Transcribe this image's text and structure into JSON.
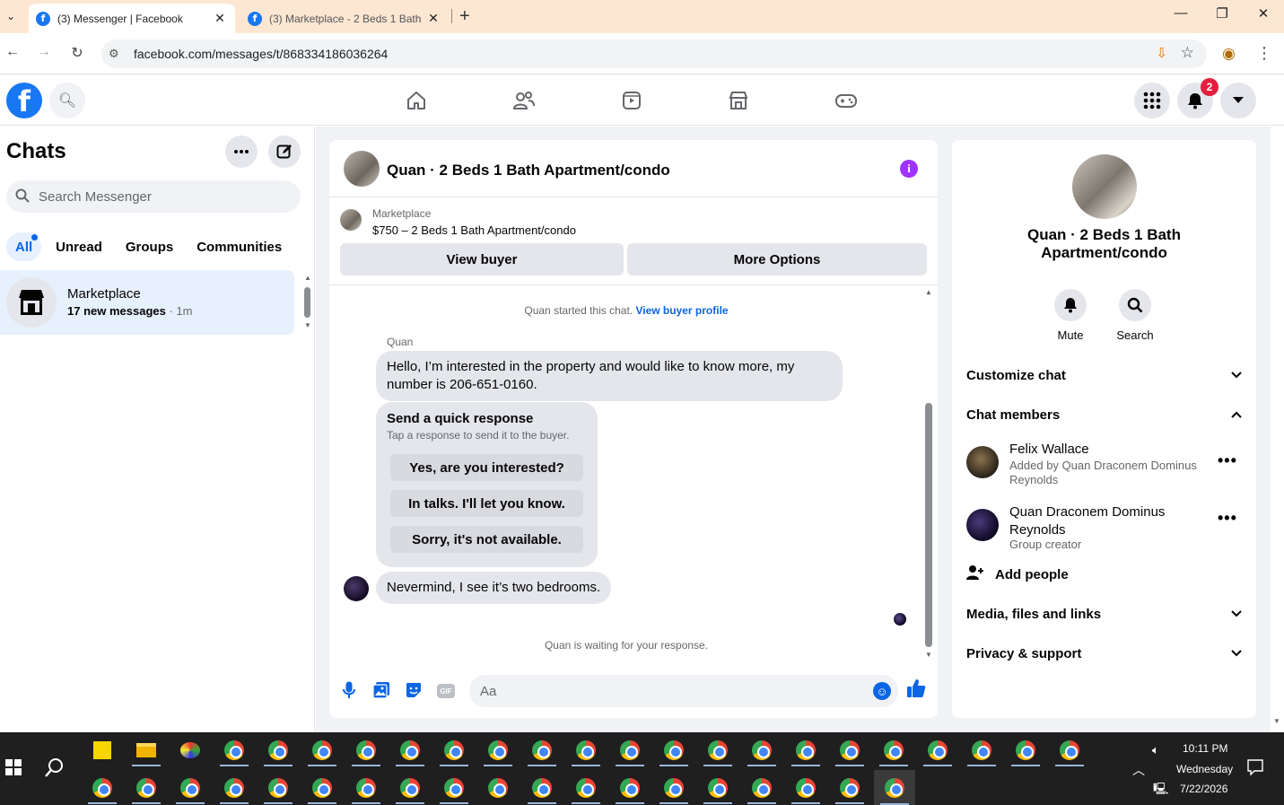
{
  "browser": {
    "tabs": [
      {
        "title": "(3) Messenger | Facebook",
        "close": "✕"
      },
      {
        "title": "(3) Marketplace - 2 Beds 1 Bath",
        "close": "✕"
      }
    ],
    "new_tab": "+",
    "url": "facebook.com/messages/t/868334186036264",
    "window_controls": {
      "minimize": "—",
      "restore": "❐",
      "close": "✕"
    }
  },
  "fb": {
    "logo": "f",
    "notifications_count": "2",
    "nav_icons": [
      "home-icon",
      "friends-icon",
      "video-icon",
      "marketplace-icon",
      "gaming-icon"
    ]
  },
  "sidebar": {
    "title": "Chats",
    "search_placeholder": "Search Messenger",
    "filters": [
      "All",
      "Unread",
      "Groups",
      "Communities"
    ],
    "chats": [
      {
        "name": "Marketplace",
        "sub": "17 new messages",
        "time": " · 1m"
      }
    ]
  },
  "chat": {
    "title": "Quan · 2 Beds 1 Bath Apartment/condo",
    "marketplace_label": "Marketplace",
    "listing": "$750 – 2 Beds 1 Bath Apartment/condo",
    "view_buyer": "View buyer",
    "more_options": "More Options",
    "started_note": "Quan started this chat. ",
    "started_link": "View buyer profile",
    "sender_name": "Quan",
    "message_1": "Hello, I’m interested in the property and would like to know more, my number is 206-651-0160.",
    "quick_response": {
      "title": "Send a quick response",
      "subtitle": "Tap a response to send it to the buyer.",
      "options": [
        "Yes, are you interested?",
        "In talks. I'll let you know.",
        "Sorry, it's not available."
      ]
    },
    "message_2": "Nevermind, I see it’s two bedrooms.",
    "waiting_note": "Quan is waiting for your response.",
    "composer_placeholder": "Aa",
    "gif_label": "GIF"
  },
  "info": {
    "title": "Quan · 2 Beds 1 Bath Apartment/condo",
    "mute": "Mute",
    "search": "Search",
    "customize_chat": "Customize chat",
    "chat_members": "Chat members",
    "members": [
      {
        "name": "Felix Wallace",
        "sub": "Added by Quan Draconem Dominus Reynolds"
      },
      {
        "name": "Quan Draconem Dominus Reynolds",
        "sub": "Group creator"
      }
    ],
    "add_people": "Add people",
    "media_files_links": "Media, files and links",
    "privacy_support": "Privacy & support"
  },
  "taskbar": {
    "time": "10:11 PM",
    "day": "Wednesday",
    "date": "7/22/2026"
  },
  "colors": {
    "fb_blue": "#1877f2",
    "messenger_blue": "#0a66e4",
    "badge_red": "#e41e3f",
    "info_purple": "#a033ff",
    "tabbar_bg": "#fde7d3"
  }
}
